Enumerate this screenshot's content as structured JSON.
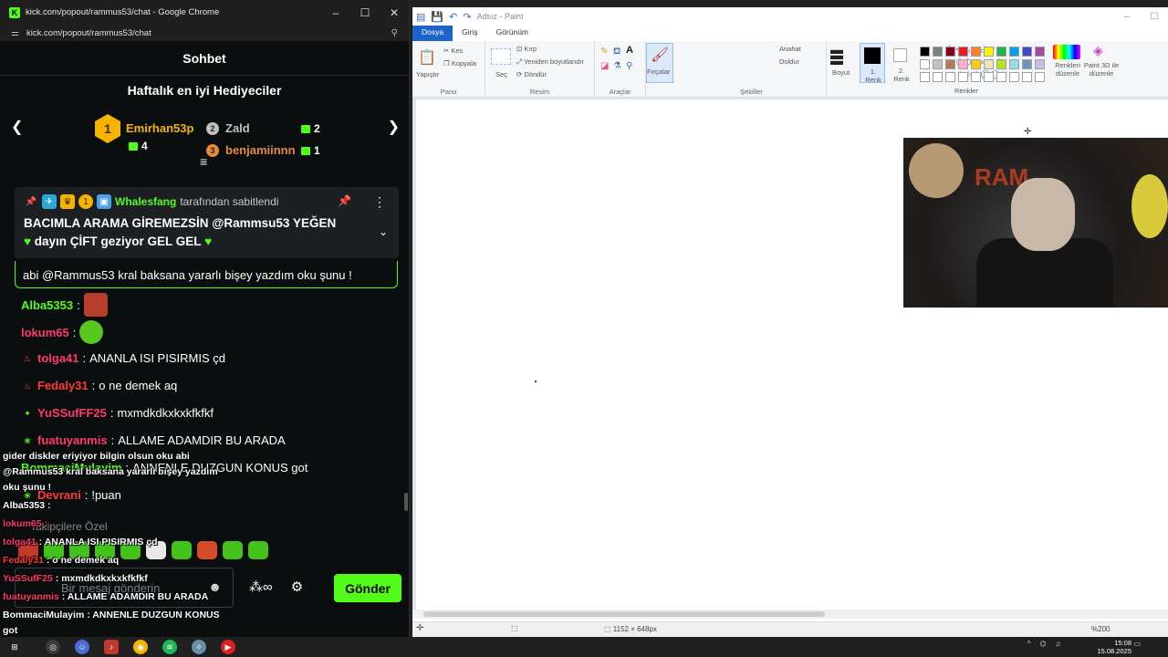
{
  "chrome": {
    "title": "kick.com/popout/rammus53/chat - Google Chrome",
    "url": "kick.com/popout/rammus53/chat",
    "favicon_letter": "K"
  },
  "chat": {
    "header": "Sohbet",
    "gifters_title": "Haftalık en iyi Hediyeciler",
    "gifters": [
      {
        "rank": "1",
        "name": "Emirhan53p",
        "count": "4",
        "color": "#f4b400"
      },
      {
        "rank": "2",
        "name": "Zald",
        "count": "2",
        "color": "#c0c0c0"
      },
      {
        "rank": "3",
        "name": "benjamiinnn",
        "count": "1",
        "color": "#e88a3a"
      }
    ],
    "pinned": {
      "badge_number": "1",
      "by_user": "Whalesfang",
      "by_suffix": "tarafından sabitlendi",
      "text_line1": "BACIMLA ARAMA GİREMEZSİN @Rammsu53 YEĞEN",
      "text_line2": "dayın ÇİFT geziyor GEL GEL"
    },
    "reply_text": "abi @Rammus53 kral baksana yararlı bişey yazdım oku şunu !",
    "messages": [
      {
        "user": "Alba5353",
        "sep": ":",
        "text": "",
        "user_color": "#53fc18"
      },
      {
        "user": "lokum65",
        "sep": ":",
        "text": "",
        "user_color": "#ff3a6a"
      },
      {
        "user": "tolga41",
        "sep": ":",
        "text": "ANANLA ISI PISIRMIS çd",
        "user_color": "#ff3a6a"
      },
      {
        "user": "Fedaly31",
        "sep": ":",
        "text": "o ne demek aq",
        "user_color": "#ff3a3a"
      },
      {
        "user": "YuSSufFF25",
        "sep": ":",
        "text": "mxmdkdkxkxkfkfkf",
        "user_color": "#ff3a6a"
      },
      {
        "user": "fuatuyanmis",
        "sep": ":",
        "text": "ALLAME ADAMDIR BU ARADA",
        "user_color": "#ff3a6a"
      },
      {
        "user": "BommaciMulayim",
        "sep": ":",
        "text": "ANNENLE DUZGUN KONUS got",
        "user_color": "#53fc18"
      },
      {
        "user": "Devrani",
        "sep": ":",
        "text": "!puan",
        "user_color": "#ff3a3a"
      }
    ],
    "filter_label": "Takipçilere Özel",
    "input_placeholder": "Bir mesaj gönderin",
    "send_label": "Gönder"
  },
  "overlay": [
    {
      "text": "gider diskler eriyiyor bilgin olsun oku abi",
      "user": "",
      "color": "#ffffff"
    },
    {
      "text": "@Rammus53 kral baksana yararlı bişey yazdım",
      "user": "",
      "color": "#ffffff"
    },
    {
      "text": "oku şunu !",
      "user": "",
      "color": "#ffffff"
    },
    {
      "text": " :",
      "user": "Alba5353",
      "color": "#ffffff"
    },
    {
      "text": " :",
      "user": "lokum65",
      "color": "#ff3a6a"
    },
    {
      "text": " : ANANLA ISI PISIRMIS çd",
      "user": "tolga41",
      "color": "#ff3a6a"
    },
    {
      "text": " : o ne demek aq",
      "user": "Fedaly31",
      "color": "#ff3a3a"
    },
    {
      "text": " : mxmdkdkxkxkfkfkf",
      "user": "YuSSufF25",
      "color": "#ff3a6a"
    },
    {
      "text": " : ALLAME ADAMDIR BU ARADA",
      "user": "fuatuyanmis",
      "color": "#ff3a6a"
    },
    {
      "text": " : ANNENLE DUZGUN KONUS",
      "user": "BommaciMulayim",
      "color": "#ffffff"
    },
    {
      "text": "got",
      "user": "",
      "color": "#ffffff"
    }
  ],
  "paint": {
    "title": "Adsız - Paint",
    "tabs": [
      "Dosya",
      "Giriş",
      "Görünüm"
    ],
    "ribbon": {
      "paste": "Yapıştır",
      "cut": "Kes",
      "copy": "Kopyala",
      "clipboard_group": "Pano",
      "select": "Seç",
      "crop": "Kırp",
      "resize": "Yeniden boyutlandır",
      "rotate": "Döndür",
      "image_group": "Resim",
      "tools_group": "Araçlar",
      "brushes": "Fırçalar",
      "outline": "Anahat",
      "fill": "Doldur",
      "shapes_group": "Şekiller",
      "size": "Boyut",
      "color1": "1. Renk",
      "color2": "2. Renk",
      "edit_colors": "Renkleri düzenle",
      "paint3d": "Paint 3D ile düzenle",
      "colors_group": "Renkler"
    },
    "palette": [
      "#000000",
      "#7f7f7f",
      "#880015",
      "#ed1c24",
      "#ff7f27",
      "#fff200",
      "#22b14c",
      "#00a2e8",
      "#3f48cc",
      "#a349a4",
      "#ffffff",
      "#c3c3c3",
      "#b97a57",
      "#ffaec9",
      "#ffc90e",
      "#efe4b0",
      "#b5e61d",
      "#99d9ea",
      "#7092be",
      "#c8bfe7"
    ],
    "canvas_size": "1152 × 648px",
    "zoom": "%200"
  },
  "taskbar": {
    "time": "15:08",
    "date": "15.08.2025"
  }
}
